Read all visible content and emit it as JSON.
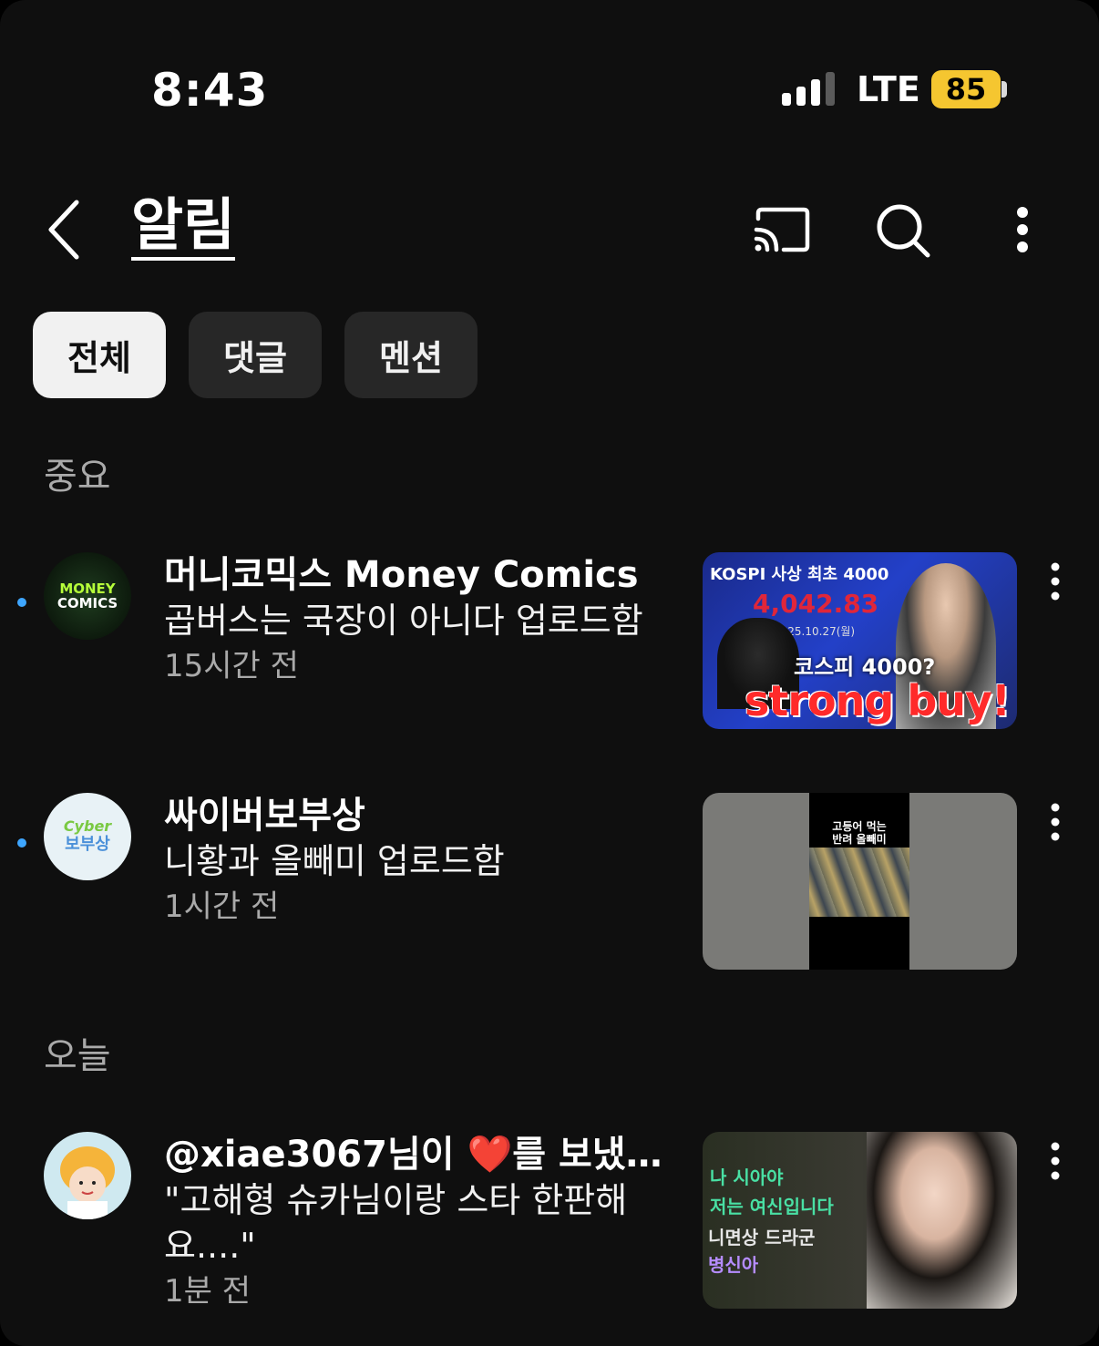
{
  "status_bar": {
    "time": "8:43",
    "network": "LTE",
    "battery": "85"
  },
  "header": {
    "title": "알림"
  },
  "chips": [
    {
      "label": "전체",
      "active": true
    },
    {
      "label": "댓글",
      "active": false
    },
    {
      "label": "멘션",
      "active": false
    }
  ],
  "sections": {
    "important": "중요",
    "today": "오늘"
  },
  "notifications": [
    {
      "channel": "머니코믹스 Money Comics",
      "body": "곱버스는 국장이 아니다 업로드함",
      "time": "15시간 전",
      "unread": true,
      "avatar_text_1": "MONEY",
      "avatar_text_2": "COMICS",
      "thumb": {
        "top_text": "KOSPI 사상 최초 4000",
        "number": "4,042.83",
        "date": "2025.10.27(월)",
        "caption": "코스피 4000?",
        "headline": "strong buy!"
      }
    },
    {
      "channel": "싸이버보부상",
      "body": "니황과 올빼미 업로드함",
      "time": "1시간 전",
      "unread": true,
      "avatar_text_1": "Cyber",
      "avatar_text_2": "보부상",
      "thumb": {
        "line1": "고등어 먹는",
        "line2": "반려 올빼미"
      }
    },
    {
      "channel": "@xiae3067님이 ❤️를 보냈습…",
      "body": "\"고해형  슈카님이랑 스타 한판해요....\"",
      "time": "1분 전",
      "unread": false,
      "thumb": {
        "line1": "나 시아야",
        "line2": "저는 여신입니다",
        "line3": "니면상 드라군",
        "line4": "병신아"
      }
    }
  ],
  "colors": {
    "background": "#0f0f0f",
    "chip_active": "#f1f1f1",
    "chip": "#272727",
    "unread_dot": "#3ea6ff",
    "battery": "#f5c630"
  }
}
